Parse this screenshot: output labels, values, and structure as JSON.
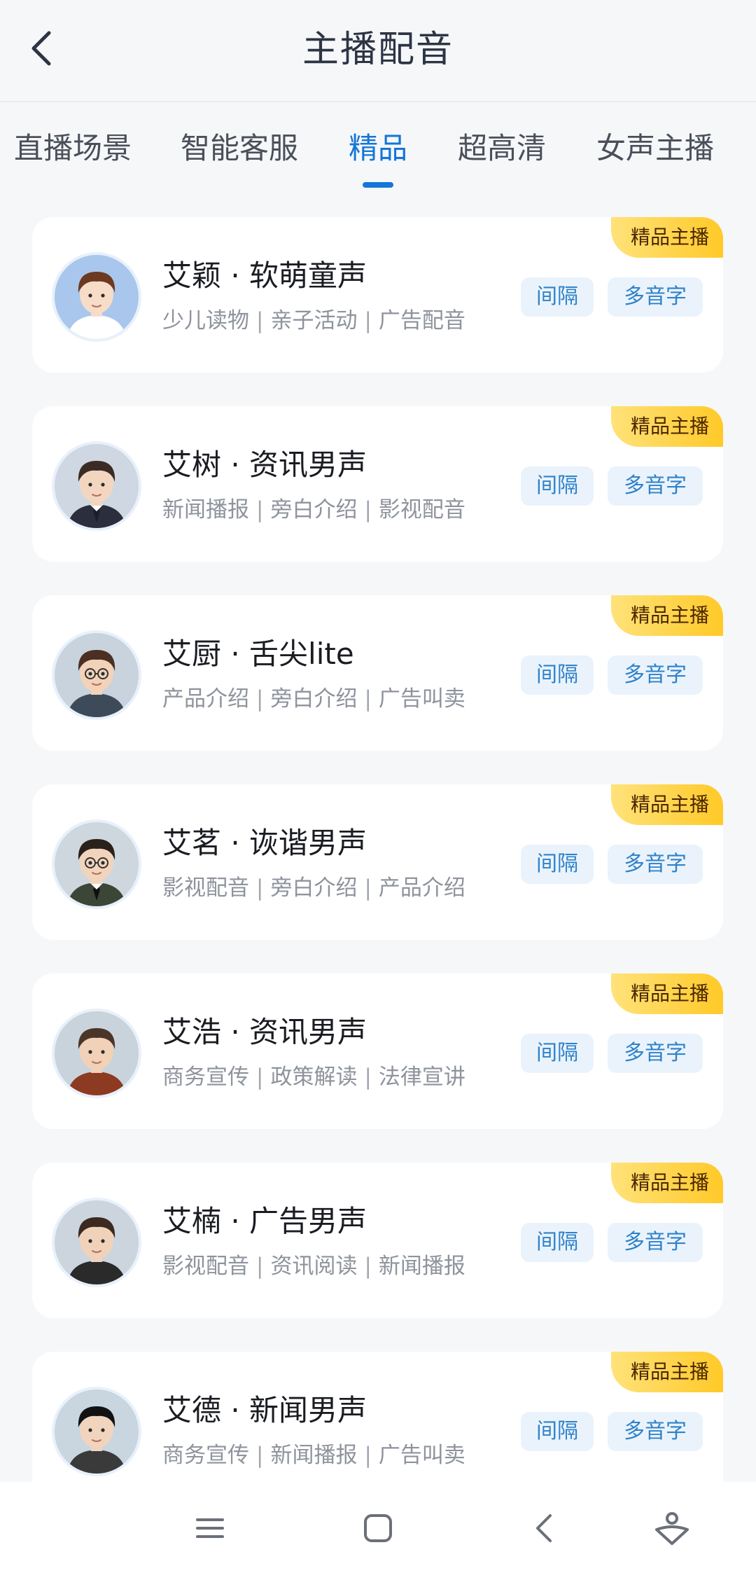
{
  "header": {
    "title": "主播配音"
  },
  "tabs": [
    {
      "label": "直播场景",
      "active": false
    },
    {
      "label": "智能客服",
      "active": false
    },
    {
      "label": "精品",
      "active": true
    },
    {
      "label": "超高清",
      "active": false
    },
    {
      "label": "女声主播",
      "active": false
    }
  ],
  "cards": [
    {
      "name": "艾颖 · 软萌童声",
      "tags": [
        "少儿读物",
        "亲子活动",
        "广告配音"
      ],
      "badge": "精品主播",
      "btn_interval": "间隔",
      "btn_poly": "多音字",
      "avatar": "child"
    },
    {
      "name": "艾树 · 资讯男声",
      "tags": [
        "新闻播报",
        "旁白介绍",
        "影视配音"
      ],
      "badge": "精品主播",
      "btn_interval": "间隔",
      "btn_poly": "多音字",
      "avatar": "suit"
    },
    {
      "name": "艾厨 · 舌尖lite",
      "tags": [
        "产品介绍",
        "旁白介绍",
        "广告叫卖"
      ],
      "badge": "精品主播",
      "btn_interval": "间隔",
      "btn_poly": "多音字",
      "avatar": "glasses"
    },
    {
      "name": "艾茗 · 诙谐男声",
      "tags": [
        "影视配音",
        "旁白介绍",
        "产品介绍"
      ],
      "badge": "精品主播",
      "btn_interval": "间隔",
      "btn_poly": "多音字",
      "avatar": "glasses-suit"
    },
    {
      "name": "艾浩 · 资讯男声",
      "tags": [
        "商务宣传",
        "政策解读",
        "法律宣讲"
      ],
      "badge": "精品主播",
      "btn_interval": "间隔",
      "btn_poly": "多音字",
      "avatar": "sweater"
    },
    {
      "name": "艾楠 · 广告男声",
      "tags": [
        "影视配音",
        "资讯阅读",
        "新闻播报"
      ],
      "badge": "精品主播",
      "btn_interval": "间隔",
      "btn_poly": "多音字",
      "avatar": "dark-jacket"
    },
    {
      "name": "艾德 · 新闻男声",
      "tags": [
        "商务宣传",
        "新闻播报",
        "广告叫卖"
      ],
      "badge": "精品主播",
      "btn_interval": "间隔",
      "btn_poly": "多音字",
      "avatar": "spiky"
    }
  ],
  "navbar": {
    "icons": [
      "menu-icon",
      "home-square-icon",
      "back-chevron-icon",
      "assistant-icon"
    ]
  },
  "colors": {
    "accent": "#1476d8",
    "badge": "#ffc928",
    "button_bg": "#eaf3fc",
    "button_text": "#2f82c9"
  }
}
